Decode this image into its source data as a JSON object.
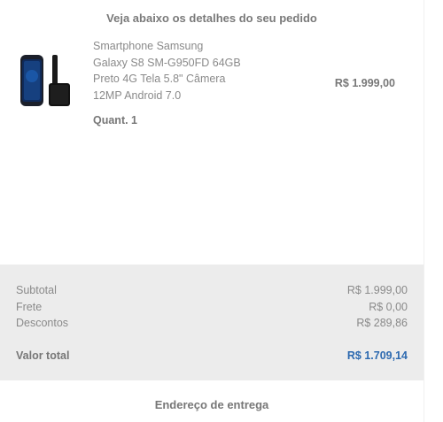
{
  "order": {
    "heading": "Veja abaixo os detalhes do seu pedido",
    "item": {
      "name_lines": [
        "Smartphone Samsung",
        "Galaxy S8 SM-G950FD 64GB",
        "Preto 4G Tela 5.8\" Câmera",
        "12MP Android 7.0"
      ],
      "price": "R$ 1.999,00",
      "quantity": "Quant. 1",
      "image_icon": "phone-product-image"
    }
  },
  "summary": {
    "subtotal_label": "Subtotal",
    "subtotal_value": "R$ 1.999,00",
    "shipping_label": "Frete",
    "shipping_value": "R$ 0,00",
    "discount_label": "Descontos",
    "discount_value": "R$ 289,86",
    "total_label": "Valor total",
    "total_value": "R$ 1.709,14"
  },
  "delivery": {
    "heading": "Endereço de entrega"
  },
  "colors": {
    "total_accent": "#2d6ab0",
    "summary_bg": "#ececec"
  }
}
